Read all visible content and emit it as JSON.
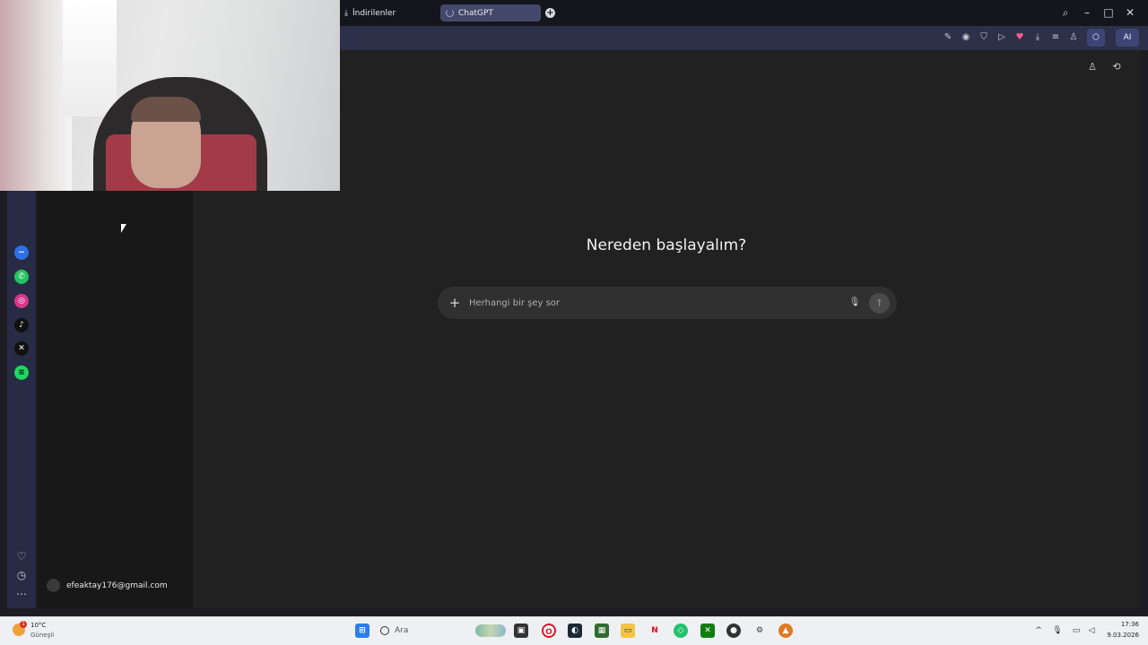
{
  "browser": {
    "tabs": [
      {
        "label": "İndirilenler",
        "icon": "download-icon"
      },
      {
        "label": "ChatGPT",
        "icon": "loading-spinner-icon",
        "active": true
      }
    ],
    "toolbar": {
      "ai_button": "AI"
    }
  },
  "sidebar": {
    "apps": [
      "messenger-icon",
      "whatsapp-icon",
      "instagram-icon",
      "tiktok-icon",
      "x-icon",
      "spotify-icon"
    ],
    "bottom": [
      "heart-icon",
      "history-icon",
      "more-icon"
    ]
  },
  "chatgpt": {
    "heading": "Nereden başlayalım?",
    "composer": {
      "placeholder": "Herhangi bir şey sor"
    },
    "account": {
      "email": "efeaktay176@gmail.com"
    }
  },
  "taskbar": {
    "weather": {
      "temp": "10°C",
      "condition": "Güneşli",
      "badge": "1"
    },
    "search_label": "Ara",
    "clock": {
      "time": "17:36",
      "date": "9.03.2026"
    }
  },
  "colors": {
    "tabbar": "#15161d",
    "addressbar": "#2c3048",
    "main_bg": "#212121",
    "composer_bg": "#303030"
  }
}
